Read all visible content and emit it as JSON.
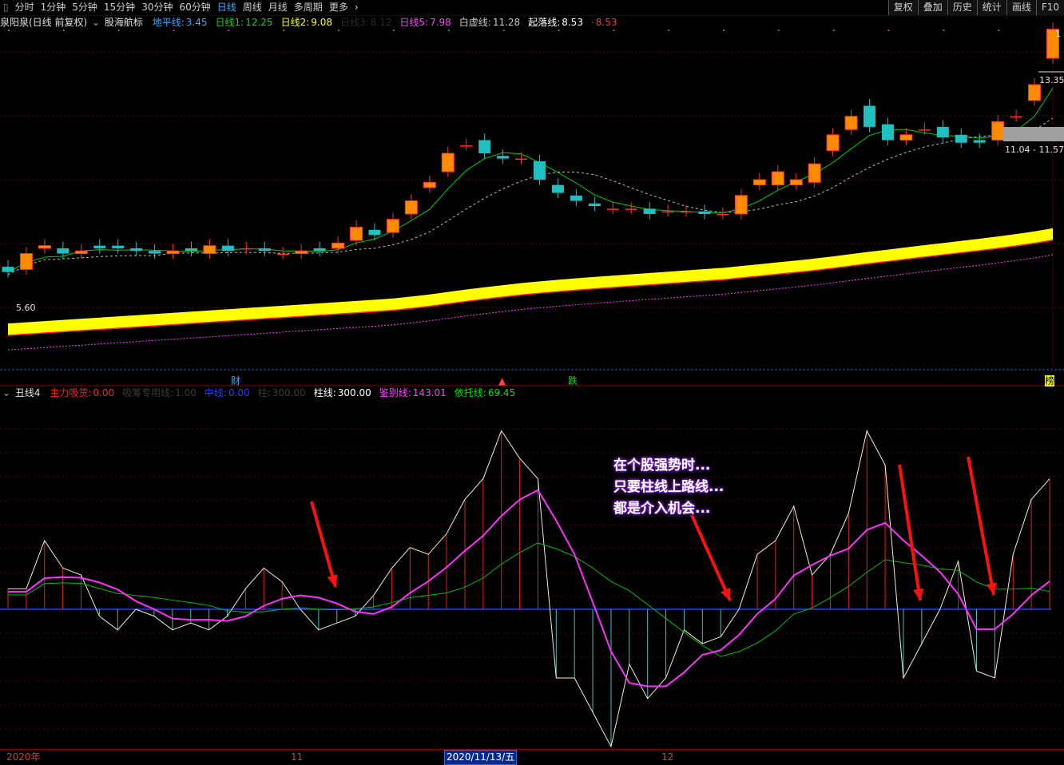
{
  "toolbar": {
    "timeframes": [
      "分时",
      "1分钟",
      "5分钟",
      "15分钟",
      "30分钟",
      "60分钟",
      "日线",
      "周线",
      "月线",
      "多周期",
      "更多"
    ],
    "active": "日线",
    "buttons": [
      "复权",
      "叠加",
      "历史",
      "统计",
      "画线",
      "F10"
    ]
  },
  "main_legend": {
    "title": "泉阳泉(日线 前复权)",
    "indicator": "股海航标",
    "items": [
      {
        "label": "地平线:",
        "value": "3.45",
        "color": "#3fa9ff"
      },
      {
        "label": "日线1:",
        "value": "12.25",
        "color": "#00e000"
      },
      {
        "label": "日线2:",
        "value": "9.08",
        "color": "#ffff00"
      },
      {
        "label": "日线3:",
        "value": "8.12",
        "color": "#2a2a2a"
      },
      {
        "label": "日线5:",
        "value": "7.98",
        "color": "#ff40ff"
      },
      {
        "label": "白虚线:",
        "value": "11.28",
        "color": "#c8c8c8"
      },
      {
        "label": "起落线:",
        "value": "8.53",
        "color": "#ffffff"
      },
      {
        "label": "·",
        "value": "8.53",
        "color": "#ff3030"
      }
    ]
  },
  "price_labels": {
    "low": "5.60",
    "high": "13.35",
    "band": "11.04 - 11.57",
    "top": "1"
  },
  "markers": {
    "cai": "财",
    "die": "跌",
    "bang": "榜"
  },
  "sub_legend": {
    "title": "丑线4",
    "items": [
      {
        "label": "主力吸货:",
        "value": "0.00",
        "color": "#ff2020"
      },
      {
        "label": "吸筹专用线:",
        "value": "1.00",
        "color": "#3a3a3a"
      },
      {
        "label": "中线:",
        "value": "0.00",
        "color": "#2040ff"
      },
      {
        "label": "柱:",
        "value": "300.00",
        "color": "#3a3a3a"
      },
      {
        "label": "柱线:",
        "value": "300.00",
        "color": "#ffffff"
      },
      {
        "label": "鉴别线:",
        "value": "143.01",
        "color": "#ff40ff"
      },
      {
        "label": "依托线:",
        "value": "69.45",
        "color": "#00e000"
      }
    ]
  },
  "callout": [
    "在个股强势时...",
    "只要柱线上路线...",
    "都是介入机会..."
  ],
  "xaxis": {
    "year": "2020年",
    "m11": "11",
    "selected": "2020/11/13/五",
    "m12": "12"
  },
  "chart_data": {
    "type": "candlestick",
    "candles": [
      {
        "o": 5.8,
        "c": 5.6
      },
      {
        "o": 5.7,
        "c": 6.3
      },
      {
        "o": 6.5,
        "c": 6.6
      },
      {
        "o": 6.5,
        "c": 6.3
      },
      {
        "o": 6.3,
        "c": 6.4
      },
      {
        "o": 6.6,
        "c": 6.5
      },
      {
        "o": 6.6,
        "c": 6.5
      },
      {
        "o": 6.5,
        "c": 6.4
      },
      {
        "o": 6.4,
        "c": 6.3
      },
      {
        "o": 6.3,
        "c": 6.4
      },
      {
        "o": 6.5,
        "c": 6.4
      },
      {
        "o": 6.3,
        "c": 6.6
      },
      {
        "o": 6.6,
        "c": 6.4
      },
      {
        "o": 6.5,
        "c": 6.5
      },
      {
        "o": 6.5,
        "c": 6.4
      },
      {
        "o": 6.3,
        "c": 6.3
      },
      {
        "o": 6.3,
        "c": 6.4
      },
      {
        "o": 6.5,
        "c": 6.4
      },
      {
        "o": 6.5,
        "c": 6.7
      },
      {
        "o": 6.8,
        "c": 7.3
      },
      {
        "o": 7.2,
        "c": 7.0
      },
      {
        "o": 7.1,
        "c": 7.6
      },
      {
        "o": 7.8,
        "c": 8.3
      },
      {
        "o": 8.8,
        "c": 9.0
      },
      {
        "o": 9.4,
        "c": 10.1
      },
      {
        "o": 10.4,
        "c": 10.4
      },
      {
        "o": 10.6,
        "c": 10.1
      },
      {
        "o": 10.0,
        "c": 9.9
      },
      {
        "o": 9.9,
        "c": 9.9
      },
      {
        "o": 9.8,
        "c": 9.1
      },
      {
        "o": 8.9,
        "c": 8.6
      },
      {
        "o": 8.5,
        "c": 8.3
      },
      {
        "o": 8.2,
        "c": 8.1
      },
      {
        "o": 8.0,
        "c": 8.0
      },
      {
        "o": 8.0,
        "c": 8.0
      },
      {
        "o": 8.0,
        "c": 7.8
      },
      {
        "o": 7.9,
        "c": 7.9
      },
      {
        "o": 7.9,
        "c": 7.9
      },
      {
        "o": 7.9,
        "c": 7.8
      },
      {
        "o": 7.8,
        "c": 7.8
      },
      {
        "o": 7.8,
        "c": 8.5
      },
      {
        "o": 8.9,
        "c": 9.1
      },
      {
        "o": 8.9,
        "c": 9.4
      },
      {
        "o": 8.9,
        "c": 9.1
      },
      {
        "o": 9.0,
        "c": 9.7
      },
      {
        "o": 10.2,
        "c": 10.8
      },
      {
        "o": 11.0,
        "c": 11.5
      },
      {
        "o": 11.9,
        "c": 11.1
      },
      {
        "o": 11.2,
        "c": 10.6
      },
      {
        "o": 10.6,
        "c": 10.8
      },
      {
        "o": 11.0,
        "c": 11.0
      },
      {
        "o": 11.1,
        "c": 10.7
      },
      {
        "o": 10.8,
        "c": 10.5
      },
      {
        "o": 10.6,
        "c": 10.5
      },
      {
        "o": 10.6,
        "c": 11.3
      },
      {
        "o": 11.5,
        "c": 11.5
      },
      {
        "o": 12.1,
        "c": 12.7
      },
      {
        "o": 13.7,
        "c": 14.8
      }
    ],
    "sub_values": [
      30,
      30,
      100,
      60,
      50,
      -10,
      -30,
      0,
      -10,
      -30,
      -20,
      -30,
      -10,
      30,
      60,
      40,
      0,
      -30,
      -20,
      -10,
      20,
      60,
      90,
      80,
      110,
      160,
      190,
      260,
      220,
      190,
      -100,
      -100,
      -150,
      -200,
      -80,
      -130,
      -100,
      -30,
      -50,
      -40,
      0,
      80,
      100,
      150,
      50,
      80,
      140,
      260,
      210,
      -100,
      -50,
      0,
      70,
      -90,
      -100,
      80,
      160,
      190
    ],
    "ylabel": ""
  }
}
